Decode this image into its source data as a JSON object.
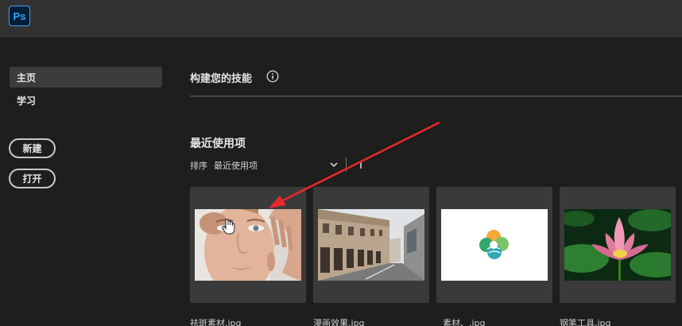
{
  "app": {
    "logo_text": "Ps"
  },
  "sidebar": {
    "items": [
      {
        "label": "主页",
        "active": true
      },
      {
        "label": "学习",
        "active": false
      }
    ],
    "buttons": {
      "new_label": "新建",
      "open_label": "打开"
    }
  },
  "main": {
    "title": "构建您的技能",
    "recent": {
      "heading": "最近使用项",
      "sort_label": "排序",
      "sort_value": "最近使用项",
      "files": [
        {
          "name": "祛斑素材.jpg"
        },
        {
          "name": "漫画效果.jpg"
        },
        {
          "name": "素材、.jpg"
        },
        {
          "name": "钢笔工具.jpg"
        }
      ]
    }
  },
  "colors": {
    "accent": "#31a8ff",
    "annotation_arrow": "#e8282a",
    "background": "#1e1e1e"
  },
  "icons": [
    "info-icon",
    "chevron-down-icon",
    "sort-direction-icon",
    "hand-cursor-icon"
  ]
}
